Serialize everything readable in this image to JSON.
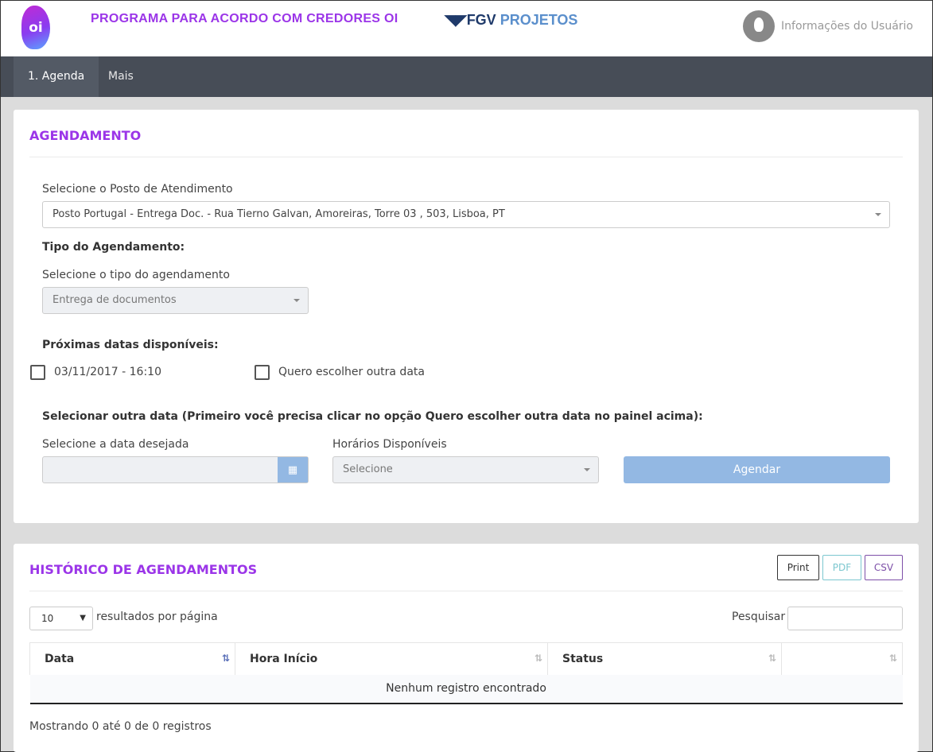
{
  "header": {
    "logo_text": "oi",
    "title": "PROGRAMA PARA ACORDO COM CREDORES OI",
    "partner_a": "FGV",
    "partner_b": "PROJETOS",
    "user_label": "Informações do Usuário"
  },
  "nav": {
    "tabs": [
      {
        "label": "1. Agenda"
      },
      {
        "label": "Mais"
      }
    ]
  },
  "agendamento": {
    "title": "AGENDAMENTO",
    "posto_label": "Selecione o Posto de Atendimento",
    "posto_value": "Posto Portugal - Entrega Doc. - Rua Tierno Galvan, Amoreiras, Torre 03 , 503, Lisboa, PT",
    "tipo_heading": "Tipo do Agendamento:",
    "tipo_label": "Selecione o tipo do agendamento",
    "tipo_value": "Entrega de documentos",
    "proximas_heading": "Próximas datas disponíveis:",
    "option_date": "03/11/2017 - 16:10",
    "option_other": "Quero escolher outra data",
    "outra_heading": "Selecionar outra data (Primeiro você precisa clicar no opção Quero escolher outra data no painel acima):",
    "data_label": "Selecione a data desejada",
    "horarios_label": "Horários Disponíveis",
    "horarios_placeholder": "Selecione",
    "agendar": "Agendar"
  },
  "historico": {
    "title": "HISTÓRICO DE AGENDAMENTOS",
    "buttons": {
      "print": "Print",
      "pdf": "PDF",
      "csv": "CSV"
    },
    "page_length": "10",
    "page_length_suffix": "resultados por página",
    "search_label": "Pesquisar",
    "columns": [
      "Data",
      "Hora Início",
      "Status",
      ""
    ],
    "empty": "Nenhum registro encontrado",
    "info": "Mostrando 0 até 0 de 0 registros"
  }
}
